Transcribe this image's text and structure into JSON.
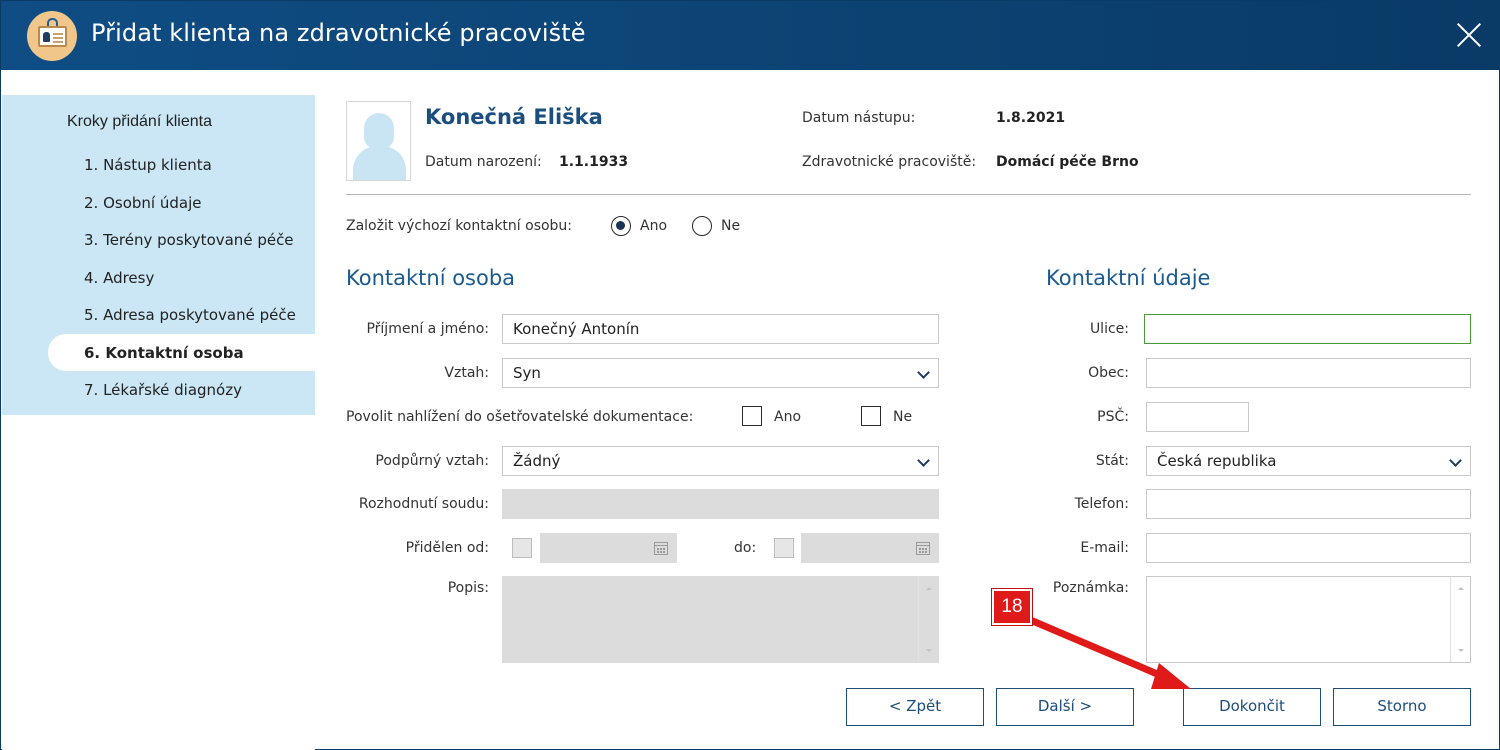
{
  "window": {
    "title": "Přidat klienta na zdravotnické pracoviště"
  },
  "sidebar": {
    "heading": "Kroky přidání klienta",
    "steps": [
      {
        "label": "1. Nástup klienta"
      },
      {
        "label": "2. Osobní údaje"
      },
      {
        "label": "3. Terény poskytované péče"
      },
      {
        "label": "4. Adresy"
      },
      {
        "label": "5. Adresa poskytované péče"
      },
      {
        "label": "6. Kontaktní osoba"
      },
      {
        "label": "7. Lékařské diagnózy"
      }
    ],
    "active_index": 5
  },
  "header": {
    "client_name": "Konečná Eliška",
    "birth_label": "Datum narození:",
    "birth_value": "1.1.1933",
    "start_label": "Datum nástupu:",
    "start_value": "1.8.2021",
    "workplace_label": "Zdravotnické pracoviště:",
    "workplace_value": "Domácí péče Brno"
  },
  "default_contact": {
    "label": "Založit výchozí kontaktní osobu:",
    "options": [
      "Ano",
      "Ne"
    ],
    "selected": "Ano"
  },
  "contact_person": {
    "title": "Kontaktní osoba",
    "name_label": "Příjmení a jméno:",
    "name_value": "Konečný Antonín",
    "relation_label": "Vztah:",
    "relation_value": "Syn",
    "access_label": "Povolit nahlížení do ošetřovatelské dokumentace:",
    "access_yes": "Ano",
    "access_no": "Ne",
    "support_label": "Podpůrný vztah:",
    "support_value": "Žádný",
    "court_label": "Rozhodnutí soudu:",
    "assigned_from_label": "Přidělen od:",
    "assigned_to_label": "do:",
    "description_label": "Popis:"
  },
  "contact_details": {
    "title": "Kontaktní údaje",
    "street_label": "Ulice:",
    "city_label": "Obec:",
    "zip_label": "PSČ:",
    "country_label": "Stát:",
    "country_value": "Česká republika",
    "phone_label": "Telefon:",
    "email_label": "E-mail:",
    "note_label": "Poznámka:"
  },
  "buttons": {
    "back": "< Zpět",
    "next": "Další >",
    "finish": "Dokončit",
    "cancel": "Storno"
  },
  "annotation": {
    "number": "18",
    "color": "#e01919"
  },
  "colors": {
    "titlebar": "#0c4272",
    "sidebar_panel": "#cbe6f4",
    "accent_text": "#1a5a8e"
  }
}
